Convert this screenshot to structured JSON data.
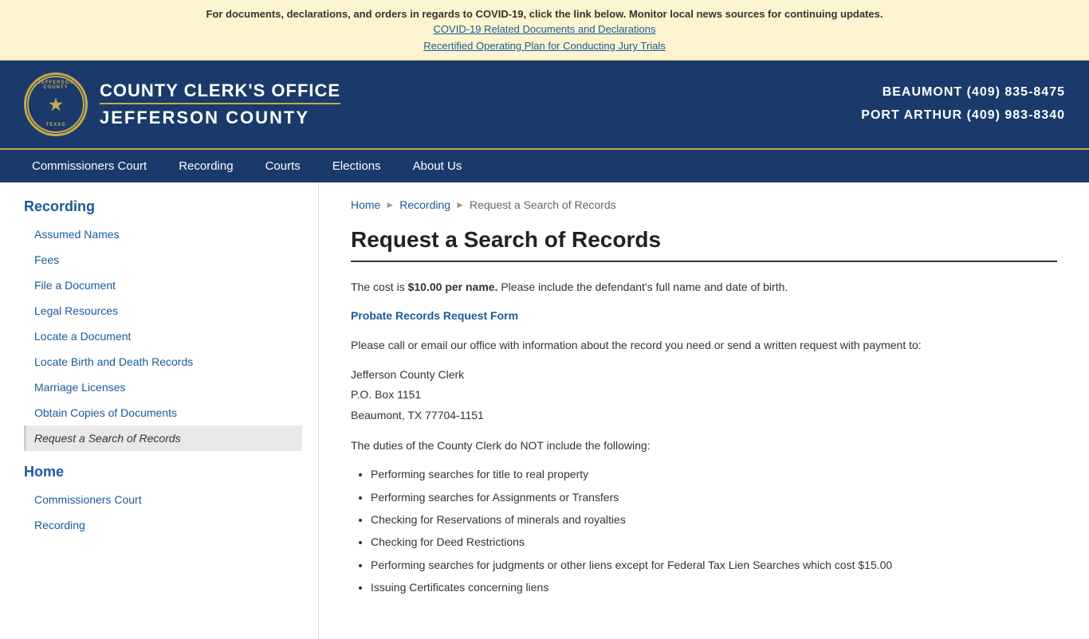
{
  "alert": {
    "main_text": "For documents, declarations, and orders in regards to COVID-19, click the link below. Monitor local news sources for continuing updates.",
    "link1_text": "COVID-19 Related Documents and Declarations",
    "link2_text": "Recertified Operating Plan for Conducting Jury Trials"
  },
  "header": {
    "seal_top": "JEFFERSON COUNTY",
    "seal_bottom": "TEXAS",
    "office_line1": "COUNTY CLERK'S OFFICE",
    "office_line2": "JEFFERSON COUNTY",
    "contact_beaumont": "BEAUMONT (409) 835-8475",
    "contact_port_arthur": "PORT ARTHUR (409) 983-8340"
  },
  "nav": {
    "items": [
      {
        "label": "Commissioners Court"
      },
      {
        "label": "Recording"
      },
      {
        "label": "Courts"
      },
      {
        "label": "Elections"
      },
      {
        "label": "About Us"
      }
    ]
  },
  "sidebar": {
    "sections": [
      {
        "title": "Recording",
        "links": [
          {
            "label": "Assumed Names",
            "active": false
          },
          {
            "label": "Fees",
            "active": false
          },
          {
            "label": "File a Document",
            "active": false
          },
          {
            "label": "Legal Resources",
            "active": false
          },
          {
            "label": "Locate a Document",
            "active": false
          },
          {
            "label": "Locate Birth and Death Records",
            "active": false
          },
          {
            "label": "Marriage Licenses",
            "active": false
          },
          {
            "label": "Obtain Copies of Documents",
            "active": false
          },
          {
            "label": "Request a Search of Records",
            "active": true
          }
        ]
      },
      {
        "title": "Home",
        "links": [
          {
            "label": "Commissioners Court",
            "active": false
          },
          {
            "label": "Recording",
            "active": false
          }
        ]
      }
    ]
  },
  "breadcrumb": {
    "home": "Home",
    "section": "Recording",
    "current": "Request a Search of Records"
  },
  "main": {
    "page_title": "Request a Search of Records",
    "cost_prefix": "The cost is ",
    "cost_bold": "$10.00 per name.",
    "cost_suffix": " Please include the defendant's full name and date of birth.",
    "form_link_text": "Probate Records Request Form",
    "paragraph2": "Please call or email our office with information about the record you need or send a written request with payment to:",
    "address_line1": "Jefferson County Clerk",
    "address_line2": "P.O. Box 1151",
    "address_line3": "Beaumont, TX 77704-1151",
    "duties_intro": "The duties of the County Clerk do NOT include the following:",
    "duties_list": [
      "Performing searches for title to real property",
      "Performing searches for Assignments or Transfers",
      "Checking for Reservations of minerals and royalties",
      "Checking for Deed Restrictions",
      "Performing searches for judgments or other liens except for Federal Tax Lien Searches which cost $15.00",
      "Issuing Certificates concerning liens"
    ]
  }
}
